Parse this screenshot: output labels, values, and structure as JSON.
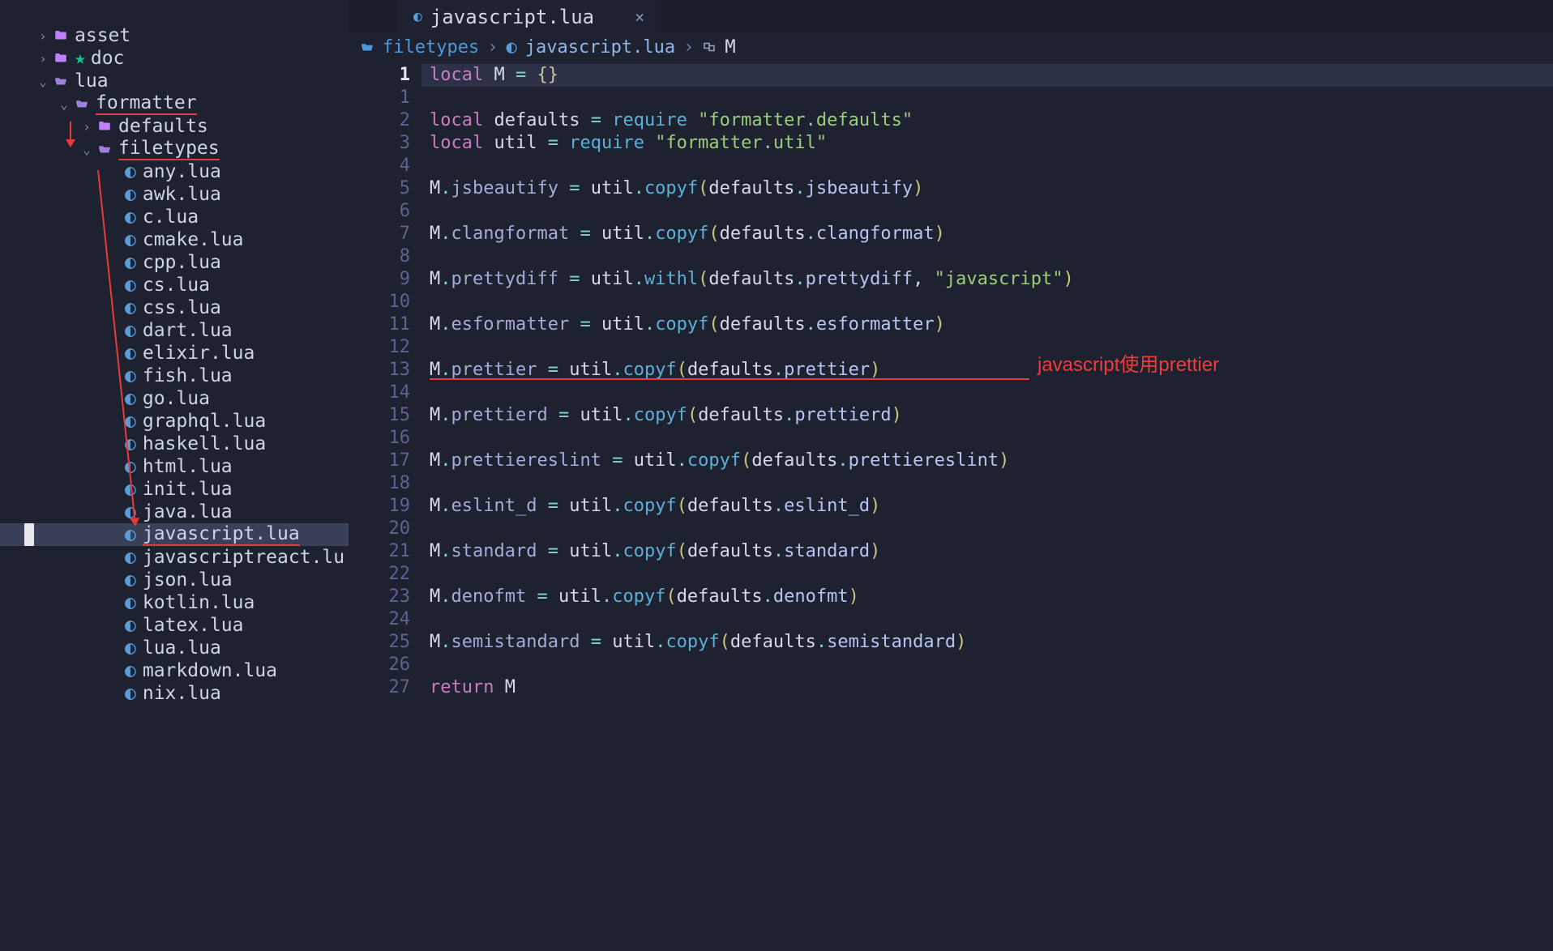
{
  "tab": {
    "filename": "javascript.lua",
    "close": "×"
  },
  "breadcrumbs": {
    "folder_icon": "folder",
    "folder": "filetypes",
    "sep": "›",
    "file": "javascript.lua",
    "symbol_icon": "ns",
    "symbol": "M"
  },
  "tree": {
    "asset": "asset",
    "doc": "doc",
    "lua": "lua",
    "formatter": "formatter",
    "defaults": "defaults",
    "filetypes": "filetypes",
    "files": [
      "any.lua",
      "awk.lua",
      "c.lua",
      "cmake.lua",
      "cpp.lua",
      "cs.lua",
      "css.lua",
      "dart.lua",
      "elixir.lua",
      "fish.lua",
      "go.lua",
      "graphql.lua",
      "haskell.lua",
      "html.lua",
      "init.lua",
      "java.lua",
      "javascript.lua",
      "javascriptreact.lu",
      "json.lua",
      "kotlin.lua",
      "latex.lua",
      "lua.lua",
      "markdown.lua",
      "nix.lua"
    ]
  },
  "code": {
    "lines_total": 27,
    "current_line": 1,
    "l1_local": "local",
    "l1_m": "M",
    "l1_eq": "=",
    "l1_br": "{}",
    "l2_local": "local",
    "l2_def": "defaults",
    "l2_req": "require",
    "l2_str": "\"formatter.defaults\"",
    "l3_local": "local",
    "l3_util": "util",
    "l3_req": "require",
    "l3_str": "\"formatter.util\"",
    "m": "M",
    "util": "util",
    "defaults": "defaults",
    "copyf": "copyf",
    "withl": "withl",
    "jsbeautify": "jsbeautify",
    "clangformat": "clangformat",
    "prettydiff": "prettydiff",
    "js_str": "\"javascript\"",
    "esformatter": "esformatter",
    "prettier": "prettier",
    "prettierd": "prettierd",
    "prettiereslint": "prettiereslint",
    "eslint_d": "eslint_d",
    "standard": "standard",
    "denofmt": "denofmt",
    "semistandard": "semistandard",
    "return": "return"
  },
  "annotation": "javascript使用prettier"
}
